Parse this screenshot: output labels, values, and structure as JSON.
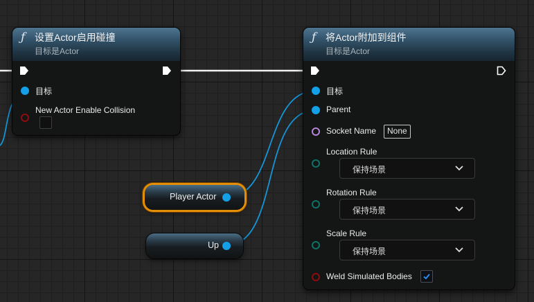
{
  "nodes": {
    "set_collision": {
      "title": "设置Actor启用碰撞",
      "subtitle": "目标是Actor",
      "pins": {
        "target": "目标",
        "enable_collision": "New Actor Enable Collision"
      },
      "enable_collision_checked": false
    },
    "attach": {
      "title": "将Actor附加到组件",
      "subtitle": "目标是Actor",
      "pins": {
        "target": "目标",
        "parent": "Parent",
        "socket_name": "Socket Name",
        "location_rule": "Location Rule",
        "rotation_rule": "Rotation Rule",
        "scale_rule": "Scale Rule",
        "weld": "Weld Simulated Bodies"
      },
      "socket_name_value": "None",
      "location_rule_value": "保持场景",
      "rotation_rule_value": "保持场景",
      "scale_rule_value": "保持场景",
      "weld_checked": true
    },
    "player_actor": {
      "label": "Player Actor",
      "selected": true
    },
    "up": {
      "label": "Up"
    }
  },
  "colors": {
    "exec": "#ffffff",
    "object_pin": "#14a0e6",
    "bool_pin": "#8f0d0d",
    "name_pin": "#b884d8",
    "enum_pin": "#0e7266",
    "selection": "#e28f06",
    "header": "#2e4c60"
  },
  "icons": {
    "function": "function-icon",
    "exec_pin": "exec-pin-icon",
    "dropdown": "chevron-down-icon",
    "checkbox": "checkmark-icon"
  }
}
